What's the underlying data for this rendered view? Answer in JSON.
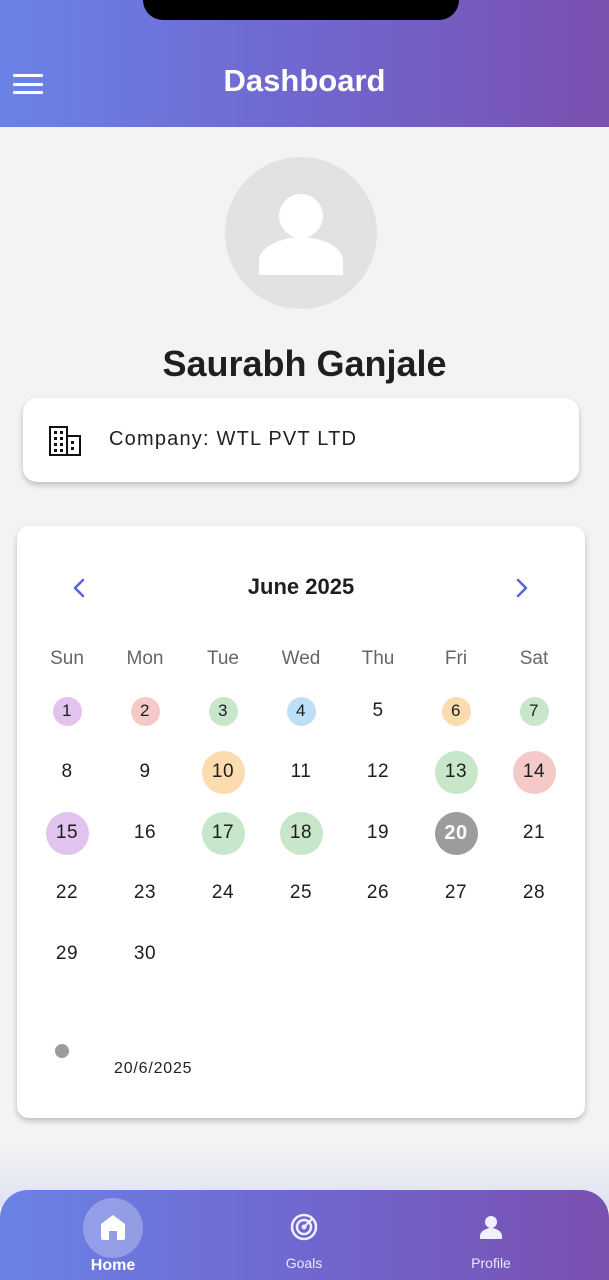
{
  "colors": {
    "accent": "#5b63dd",
    "gradient_start": "#6a82e6",
    "gradient_end": "#7a50b0"
  },
  "app_bar": {
    "title": "Dashboard",
    "menu_icon": "menu-icon"
  },
  "profile": {
    "avatar_icon": "person-icon",
    "name": "Saurabh Ganjale",
    "company_icon": "building-icon",
    "company": "Company: WTL PVT LTD"
  },
  "calendar": {
    "month": "June 2025",
    "prev_icon": "chevron-left-icon",
    "next_icon": "chevron-right-icon",
    "weekdays": [
      "Sun",
      "Mon",
      "Tue",
      "Wed",
      "Thu",
      "Fri",
      "Sat"
    ],
    "first_weekday": 0,
    "days_in_month": 30,
    "selected_day": 20,
    "marked_days": [
      {
        "day": 1,
        "color": "#e2c3ee",
        "size": "small"
      },
      {
        "day": 2,
        "color": "#f6c9c9",
        "size": "small"
      },
      {
        "day": 3,
        "color": "#c8e6c9",
        "size": "small"
      },
      {
        "day": 4,
        "color": "#bee0f7",
        "size": "small"
      },
      {
        "day": 6,
        "color": "#fbdcae",
        "size": "small"
      },
      {
        "day": 7,
        "color": "#c8e6c9",
        "size": "small"
      },
      {
        "day": 10,
        "color": "#fbdcae",
        "size": "large"
      },
      {
        "day": 13,
        "color": "#c8e6c9",
        "size": "large"
      },
      {
        "day": 14,
        "color": "#f6c9c9",
        "size": "large"
      },
      {
        "day": 15,
        "color": "#e2c3ee",
        "size": "large"
      },
      {
        "day": 17,
        "color": "#c8e6c9",
        "size": "large"
      },
      {
        "day": 18,
        "color": "#c8e6c9",
        "size": "large"
      },
      {
        "day": 20,
        "color": "#9c9c9c",
        "size": "large"
      }
    ],
    "legend": {
      "dot_color": "#9c9c9c",
      "date": "20/6/2025"
    }
  },
  "bottom_nav": {
    "items": [
      {
        "label": "Home",
        "icon": "home-icon",
        "active": true
      },
      {
        "label": "Goals",
        "icon": "target-icon",
        "active": false
      },
      {
        "label": "Profile",
        "icon": "person-icon",
        "active": false
      }
    ]
  }
}
